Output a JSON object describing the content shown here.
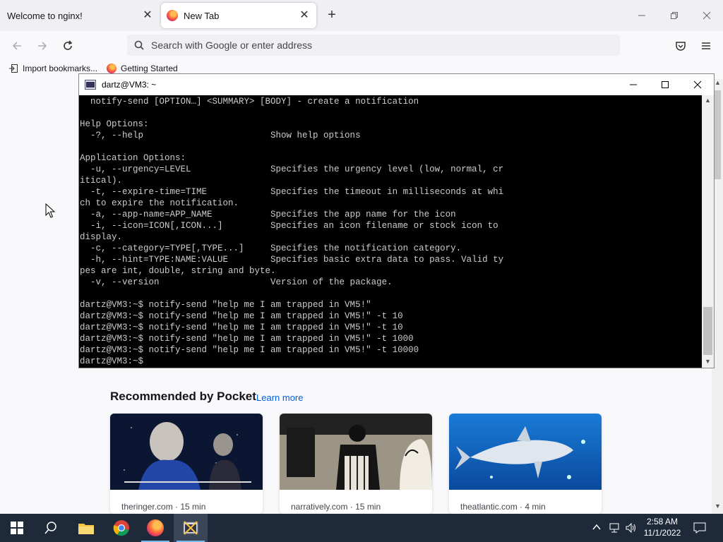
{
  "tabs": [
    {
      "label": "Welcome to nginx!"
    },
    {
      "label": "New Tab"
    }
  ],
  "urlbar": {
    "placeholder": "Search with Google or enter address"
  },
  "bookmarks": [
    {
      "label": "Import bookmarks..."
    },
    {
      "label": "Getting Started"
    }
  ],
  "terminal": {
    "title": "dartz@VM3: ~",
    "lines": [
      "  notify-send [OPTION…] <SUMMARY> [BODY] - create a notification",
      "",
      "Help Options:",
      "  -?, --help                        Show help options",
      "",
      "Application Options:",
      "  -u, --urgency=LEVEL               Specifies the urgency level (low, normal, cr",
      "itical).",
      "  -t, --expire-time=TIME            Specifies the timeout in milliseconds at whi",
      "ch to expire the notification.",
      "  -a, --app-name=APP_NAME           Specifies the app name for the icon",
      "  -i, --icon=ICON[,ICON...]         Specifies an icon filename or stock icon to",
      "display.",
      "  -c, --category=TYPE[,TYPE...]     Specifies the notification category.",
      "  -h, --hint=TYPE:NAME:VALUE        Specifies basic extra data to pass. Valid ty",
      "pes are int, double, string and byte.",
      "  -v, --version                     Version of the package.",
      "",
      "dartz@VM3:~$ notify-send \"help me I am trapped in VM5!\"",
      "dartz@VM3:~$ notify-send \"help me I am trapped in VM5!\" -t 10",
      "dartz@VM3:~$ notify-send \"help me I am trapped in VM5!\" -t 10",
      "dartz@VM3:~$ notify-send \"help me I am trapped in VM5!\" -t 1000",
      "dartz@VM3:~$ notify-send \"help me I am trapped in VM5!\" -t 10000",
      "dartz@VM3:~$ "
    ]
  },
  "pocket": {
    "title": "Recommended by Pocket",
    "learn_more": "Learn more",
    "cards": [
      {
        "meta": "theringer.com · 15 min"
      },
      {
        "meta": "narratively.com · 15 min"
      },
      {
        "meta": "theatlantic.com · 4 min"
      }
    ]
  },
  "taskbar": {
    "time": "2:58 AM",
    "date": "11/1/2022"
  },
  "colors": {
    "taskbar": "#1e2a3a",
    "terminal_bg": "#000000",
    "pocket_link": "#0061e0"
  }
}
